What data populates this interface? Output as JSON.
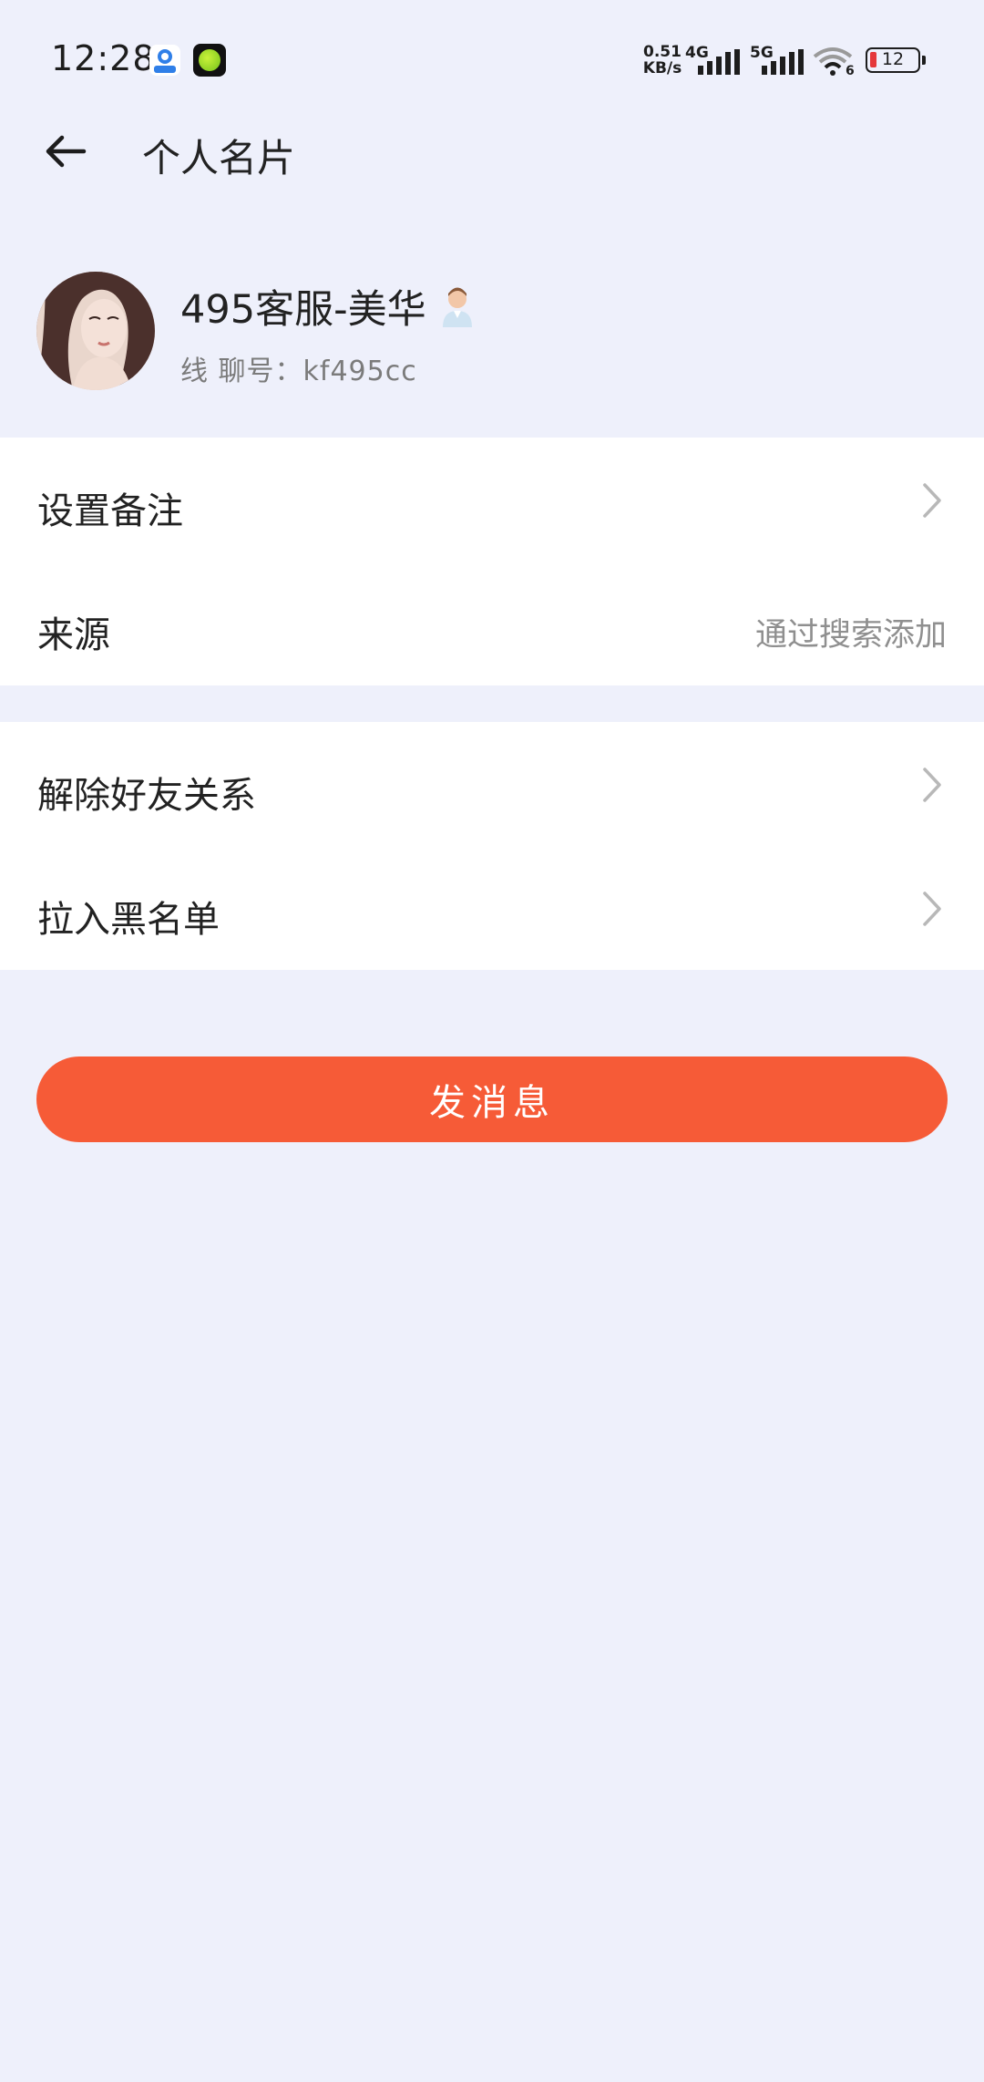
{
  "status_bar": {
    "time": "12:28",
    "net_speed_value": "0.51",
    "net_speed_unit": "KB/s",
    "signal_1_label": "4G",
    "signal_2_label": "5G",
    "wifi_badge": "6",
    "battery_level": "12"
  },
  "header": {
    "title": "个人名片"
  },
  "profile": {
    "name": "495客服-美华",
    "id_text": "线 聊号：kf495cc"
  },
  "settings": {
    "remark_label": "设置备注",
    "source_label": "来源",
    "source_value": "通过搜索添加"
  },
  "actions": {
    "unfriend_label": "解除好友关系",
    "blacklist_label": "拉入黑名单"
  },
  "send_button": {
    "label": "发消息"
  },
  "colors": {
    "background": "#eef0fb",
    "accent": "#f65b37",
    "card": "#ffffff",
    "battery_low": "#e5383b"
  }
}
